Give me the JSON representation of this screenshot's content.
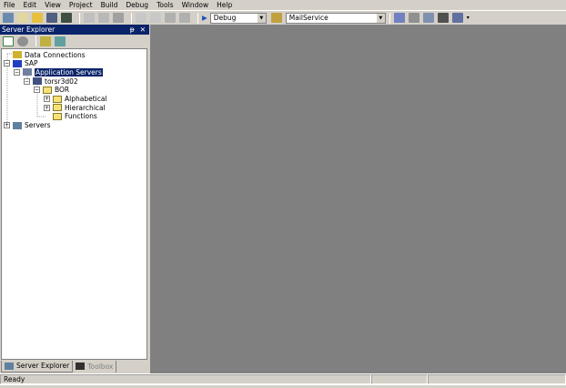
{
  "menu": [
    "File",
    "Edit",
    "View",
    "Project",
    "Build",
    "Debug",
    "Tools",
    "Window",
    "Help"
  ],
  "toolbar": {
    "config": "Debug",
    "project": "MailService"
  },
  "panel": {
    "title": "Server Explorer",
    "pin": "ᵽ",
    "close": "✕"
  },
  "tree": [
    {
      "label": "Data Connections",
      "level": 0,
      "exp": "",
      "icon": "data-connections-icon"
    },
    {
      "label": "SAP",
      "level": 0,
      "exp": "−",
      "icon": "sap-icon"
    },
    {
      "label": "Application Servers",
      "level": 1,
      "exp": "−",
      "icon": "server-icon",
      "selected": true
    },
    {
      "label": "torsr3d02",
      "level": 2,
      "exp": "−",
      "icon": "computer-icon"
    },
    {
      "label": "BOR",
      "level": 3,
      "exp": "−",
      "icon": "folder-icon"
    },
    {
      "label": "Alphabetical",
      "level": 4,
      "exp": "+",
      "icon": "folder-icon"
    },
    {
      "label": "Hierarchical",
      "level": 4,
      "exp": "+",
      "icon": "folder-icon"
    },
    {
      "label": "Functions",
      "level": 4,
      "exp": "",
      "icon": "folder-icon"
    },
    {
      "label": "Servers",
      "level": 0,
      "exp": "+",
      "icon": "servers-icon"
    }
  ],
  "tabs": [
    "Server Explorer",
    "Toolbox"
  ],
  "status": {
    "text": "Ready"
  }
}
